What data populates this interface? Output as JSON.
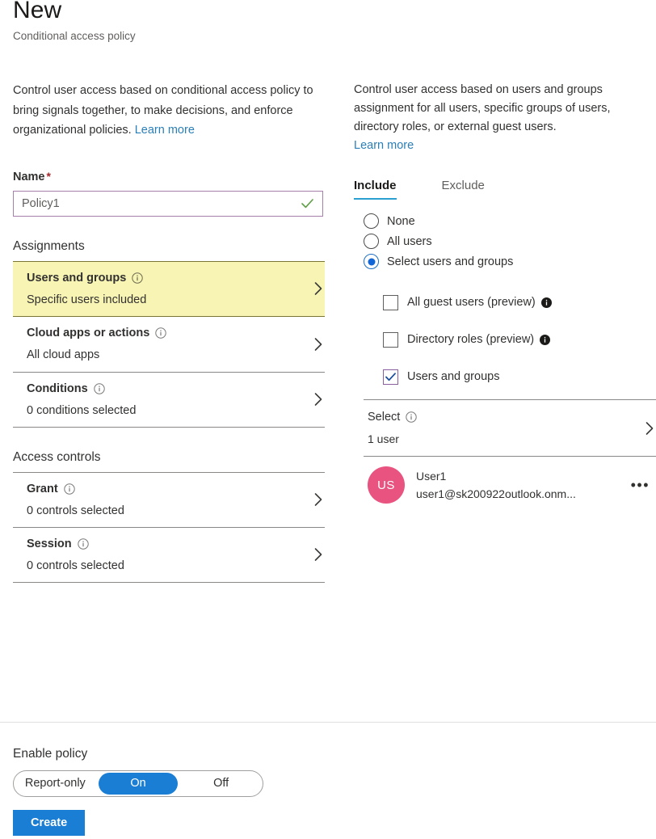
{
  "header": {
    "title": "New",
    "subtitle": "Conditional access policy"
  },
  "left": {
    "intro": "Control user access based on conditional access policy to bring signals together, to make decisions, and enforce organizational policies. ",
    "learn_more": "Learn more",
    "name_label": "Name",
    "name_required_mark": "*",
    "name_value": "Policy1",
    "name_placeholder": "Policy1",
    "assignments_heading": "Assignments",
    "access_controls_heading": "Access controls",
    "rows": [
      {
        "title": "Users and groups",
        "sub": "Specific users included",
        "highlighted": true
      },
      {
        "title": "Cloud apps or actions",
        "sub": "All cloud apps",
        "highlighted": false
      },
      {
        "title": "Conditions",
        "sub": "0 conditions selected",
        "highlighted": false
      }
    ],
    "control_rows": [
      {
        "title": "Grant",
        "sub": "0 controls selected"
      },
      {
        "title": "Session",
        "sub": "0 controls selected"
      }
    ]
  },
  "right": {
    "intro": "Control user access based on users and groups assignment for all users, specific groups of users, directory roles, or external guest users. ",
    "learn_more": "Learn more",
    "tabs": [
      {
        "label": "Include",
        "active": true
      },
      {
        "label": "Exclude",
        "active": false
      }
    ],
    "radios": [
      {
        "label": "None",
        "checked": false
      },
      {
        "label": "All users",
        "checked": false
      },
      {
        "label": "Select users and groups",
        "checked": true
      }
    ],
    "checkboxes": [
      {
        "label": "All guest users (preview)",
        "checked": false,
        "info": true
      },
      {
        "label": "Directory roles (preview)",
        "checked": false,
        "info": true
      },
      {
        "label": "Users and groups",
        "checked": true,
        "info": false
      }
    ],
    "select_row": {
      "title": "Select",
      "sub": "1 user"
    },
    "user": {
      "initials": "US",
      "name": "User1",
      "email": "user1@sk200922outlook.onm...",
      "avatar_color": "#e8537f"
    },
    "more_glyph": "•••"
  },
  "footer": {
    "enable_label": "Enable policy",
    "segments": [
      {
        "label": "Report-only",
        "active": false
      },
      {
        "label": "On",
        "active": true
      },
      {
        "label": "Off",
        "active": false
      }
    ],
    "create_label": "Create"
  },
  "colors": {
    "accent_blue": "#1a7fd4",
    "tab_underline": "#2a9fd0",
    "highlight_yellow": "#f8f4b4",
    "link": "#2a7fb8",
    "required_red": "#a4262c",
    "input_border_purple": "#a57fa9",
    "check_green": "#5e9e45"
  }
}
